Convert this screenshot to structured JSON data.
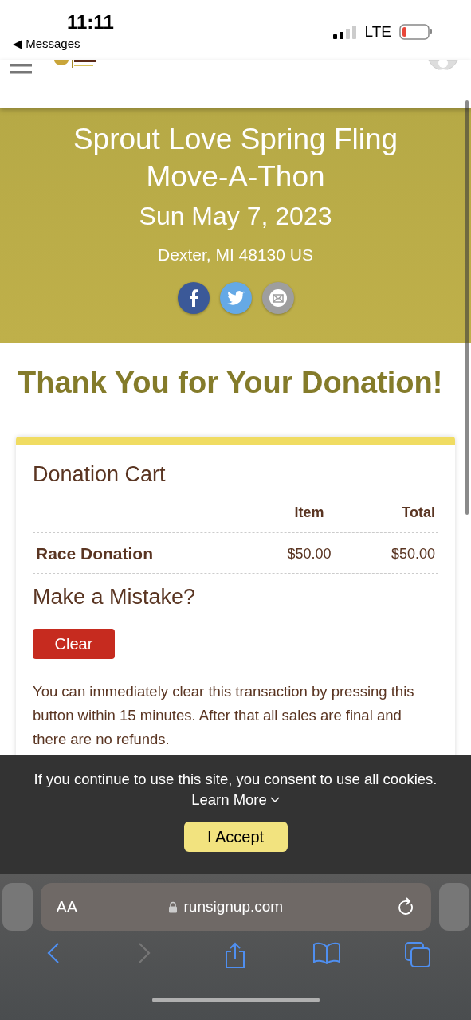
{
  "status_bar": {
    "time": "11:11",
    "back_label": "◀ Messages",
    "network": "LTE",
    "battery_low": true
  },
  "event": {
    "title": "Sprout Love Spring Fling Move-A-Thon",
    "date": "Sun May 7, 2023",
    "location": "Dexter, MI 48130 US",
    "share": [
      {
        "kind": "facebook",
        "color": "#3b5998"
      },
      {
        "kind": "twitter",
        "color": "#65a9e6"
      },
      {
        "kind": "email",
        "color": "#9e9e9e"
      }
    ]
  },
  "heading": "Thank You for Your Donation!",
  "cart": {
    "title": "Donation Cart",
    "columns": [
      "Item",
      "Total"
    ],
    "rows": [
      {
        "name": "Race Donation",
        "item": "$50.00",
        "total": "$50.00"
      }
    ],
    "mistake_title": "Make a Mistake?",
    "clear_button": "Clear",
    "note": "You can immediately clear this transaction by pressing this button within 15 minutes. After that all sales are final and there are no refunds."
  },
  "cookie_banner": {
    "message": "If you continue to use this site, you consent to use all cookies.",
    "learn_more": "Learn More",
    "accept": "I Accept"
  },
  "browser": {
    "text_size": "AA",
    "url": "runsignup.com",
    "forward_disabled": true
  }
}
